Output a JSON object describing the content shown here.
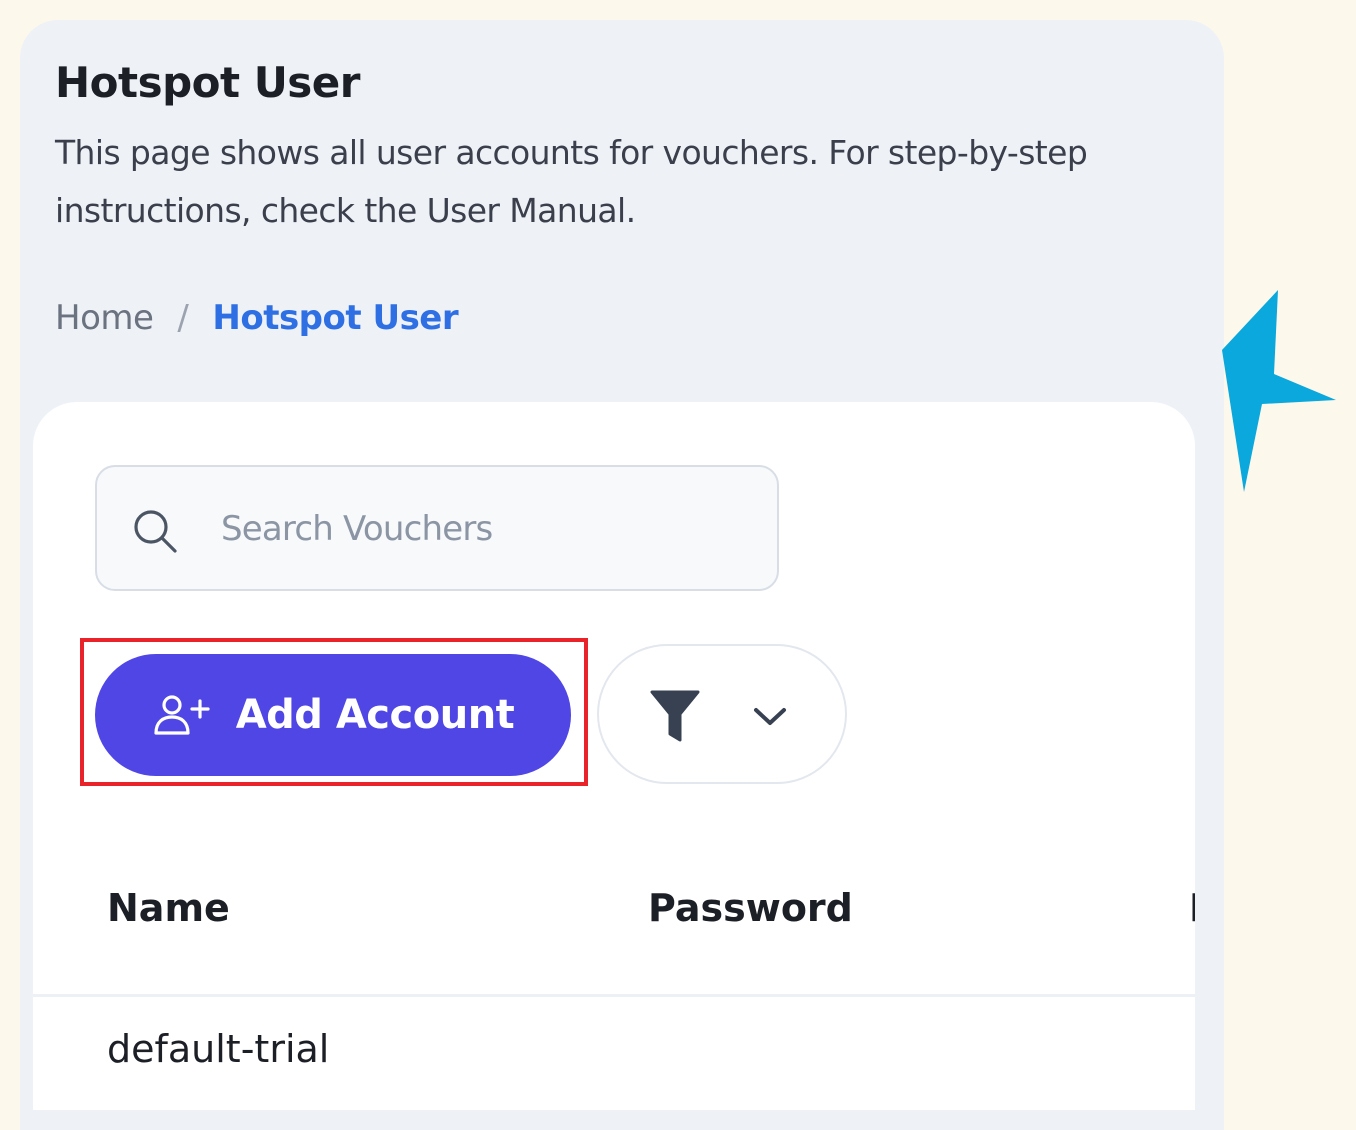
{
  "page": {
    "title": "Hotspot User",
    "description": "This page shows all user accounts for vouchers. For step-by-step instructions, check the User Manual."
  },
  "breadcrumb": {
    "home": "Home",
    "separator": "/",
    "current": "Hotspot User"
  },
  "search": {
    "placeholder": "Search Vouchers",
    "value": "",
    "icon": "search-icon"
  },
  "toolbar": {
    "add_account_label": "Add Account",
    "add_account_icon": "user-plus-icon",
    "filter_icon": "funnel-icon",
    "filter_dropdown_icon": "chevron-down-icon"
  },
  "table": {
    "columns": [
      "Name",
      "Password",
      "P"
    ],
    "rows": [
      {
        "name": "default-trial"
      }
    ]
  },
  "colors": {
    "background": "#fdf8ec",
    "panel": "#eef2f7",
    "accent": "#4f46e5",
    "link": "#2f6fe4",
    "highlight": "#e8232a",
    "decoration": "#0aa8dc"
  }
}
